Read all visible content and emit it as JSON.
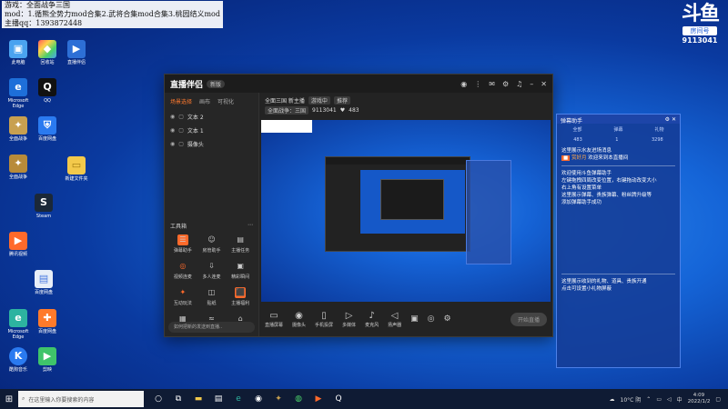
{
  "overlay": {
    "line1": "游戏：全面战争三国",
    "line2": "mod：1.循熊全势力mod合集2.武将合集mod合集3.桃园结义mod",
    "line3": "主播qq：1393872448"
  },
  "douyu": {
    "mark": "斗鱼",
    "room_label": "房间号",
    "room_id": "9113041"
  },
  "desktop_icons": [
    {
      "label": "此电脑",
      "color": "#4aa3f0",
      "glyph": "▣"
    },
    {
      "label": "回收站",
      "color": "#6ab4f5",
      "glyph": "◆"
    },
    {
      "label": "直播伴侣",
      "color": "#2d6fd6",
      "glyph": "▶"
    },
    {
      "label": "QQ",
      "color": "#222",
      "glyph": "Q"
    },
    {
      "label": "新建文件夹",
      "color": "#f3c94b",
      "glyph": "▭"
    },
    {
      "label": "全面战争",
      "color": "#c8a050",
      "glyph": "✦"
    },
    {
      "label": "腾讯视频",
      "color": "#ff6a2b",
      "glyph": "▶"
    },
    {
      "label": "Steam",
      "color": "#1b2838",
      "glyph": "S"
    },
    {
      "label": "Microsoft Edge",
      "color": "#2db3a0",
      "glyph": "e"
    },
    {
      "label": "百度网盘",
      "color": "#3a8ff0",
      "glyph": "☁"
    },
    {
      "label": "酷狗音乐",
      "color": "#2a7af0",
      "glyph": "K"
    },
    {
      "label": "剪映",
      "color": "#3fc46a",
      "glyph": "▶"
    }
  ],
  "app": {
    "logo": "直播伴侣",
    "version": "新版",
    "scene_tabs": [
      "场景选择",
      "画布",
      "可视化"
    ],
    "scenes": [
      "文本 2",
      "文本 1",
      "摄像头"
    ],
    "tools_title": "工具箱",
    "tools": [
      {
        "label": "弹幕助手",
        "color": "#ff6a2b"
      },
      {
        "label": "房管助手",
        "color": "#777"
      },
      {
        "label": "主播任务",
        "color": "#777"
      },
      {
        "label": "视频连麦",
        "color": "#ff6a2b"
      },
      {
        "label": "多人连麦",
        "color": "#777"
      },
      {
        "label": "精彩瞬间",
        "color": "#777"
      },
      {
        "label": "互动玩法",
        "color": "#ff6a2b"
      },
      {
        "label": "贴纸",
        "color": "#777"
      },
      {
        "label": "主播福利",
        "color": "#ff6a2b"
      },
      {
        "label": "更多",
        "color": "#777"
      },
      {
        "label": "",
        "color": "#777"
      },
      {
        "label": "",
        "color": "#777"
      }
    ],
    "hint": "如何把新的发送到直播..",
    "room": {
      "title": "全面三国 新主播",
      "tag1": "游戏中",
      "tag2": "推荐",
      "category": "全面战争：三国",
      "room_id": "9113041",
      "fans": "483"
    },
    "bottom_items": [
      "直播屏幕",
      "摄像头",
      "手机投屏",
      "多媒体",
      "麦克风",
      "扬声器"
    ],
    "start_button": "开始直播"
  },
  "assist": {
    "title": "弹幕助手",
    "tabs": [
      "全部",
      "弹幕",
      "礼物"
    ],
    "stats": [
      "483",
      "1",
      "3298"
    ],
    "welcome": "这里展示水友进场消息",
    "user": "赏好月",
    "user_msg": "欢迎来到本直播间",
    "para1": "欢迎使用斗鱼弹幕助手",
    "para2": "左键拖拽四周改变位置，右键拖动改变大小",
    "para3": "右上角有设置菜单",
    "para4": "这里展示弹幕、贵族弹幕、粉丝牌升级等",
    "para5": "添加弹幕助手成功",
    "gift1": "这里展示收到的礼物、道具、贵族开通",
    "gift2": "点击可设置小礼物屏蔽"
  },
  "taskbar": {
    "search_placeholder": "在这里输入你要搜索的内容",
    "temp": "10°C 阴",
    "ime": "中",
    "time": "4:09",
    "date": "2022/1/2"
  }
}
